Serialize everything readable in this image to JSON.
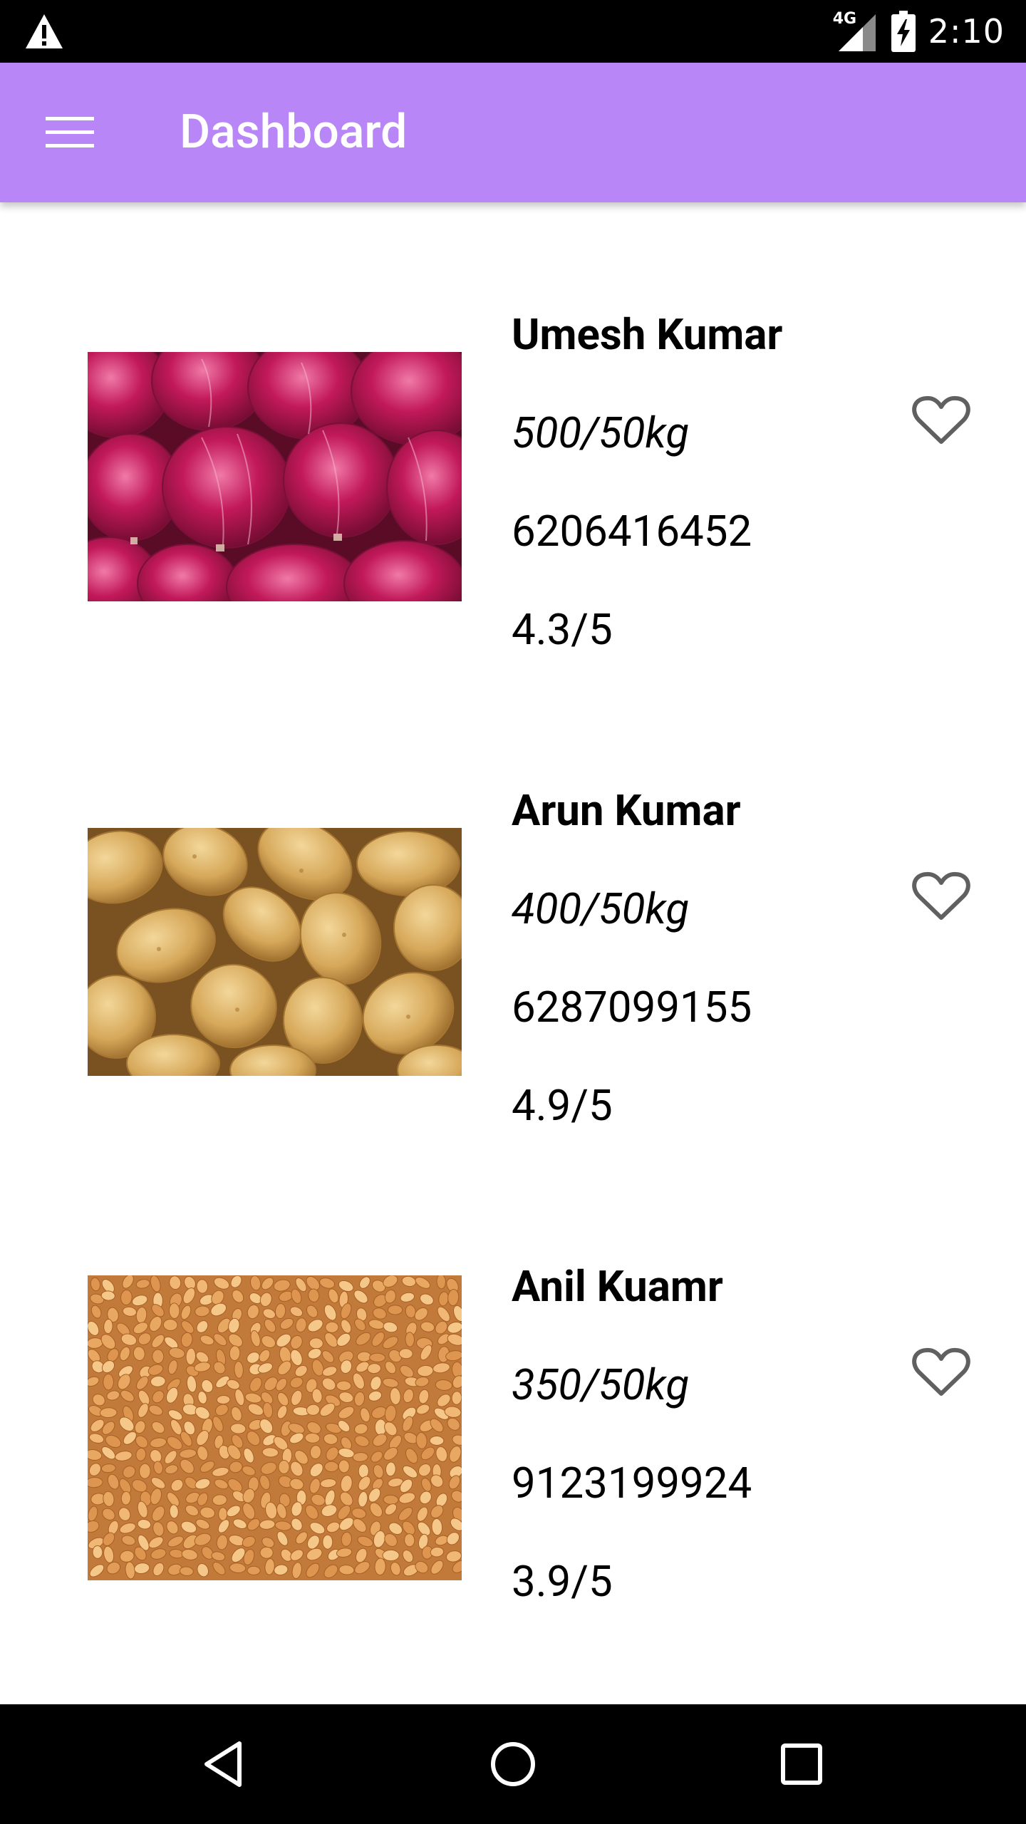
{
  "status_bar": {
    "network_label": "4G",
    "time": "2:10",
    "icons": [
      "warning-icon",
      "signal-icon",
      "battery-charging-icon"
    ]
  },
  "app_bar": {
    "title": "Dashboard",
    "menu_icon": "hamburger-menu-icon"
  },
  "listings": [
    {
      "name": "Umesh Kumar",
      "price": "500/50kg",
      "phone": "6206416452",
      "rating": "4.3/5",
      "image": "red-onions",
      "favorite_icon": "heart-outline-icon"
    },
    {
      "name": "Arun Kumar",
      "price": "400/50kg",
      "phone": "6287099155",
      "rating": "4.9/5",
      "image": "potatoes",
      "favorite_icon": "heart-outline-icon"
    },
    {
      "name": "Anil Kuamr",
      "price": "350/50kg",
      "phone": "9123199924",
      "rating": "3.9/5",
      "image": "wheat-grains",
      "favorite_icon": "heart-outline-icon"
    }
  ],
  "nav_bar": {
    "icons": [
      "back-icon",
      "home-icon",
      "recents-icon"
    ]
  },
  "colors": {
    "app_bar": "#b886f7",
    "status_bar": "#000000",
    "nav_bar": "#000000"
  }
}
